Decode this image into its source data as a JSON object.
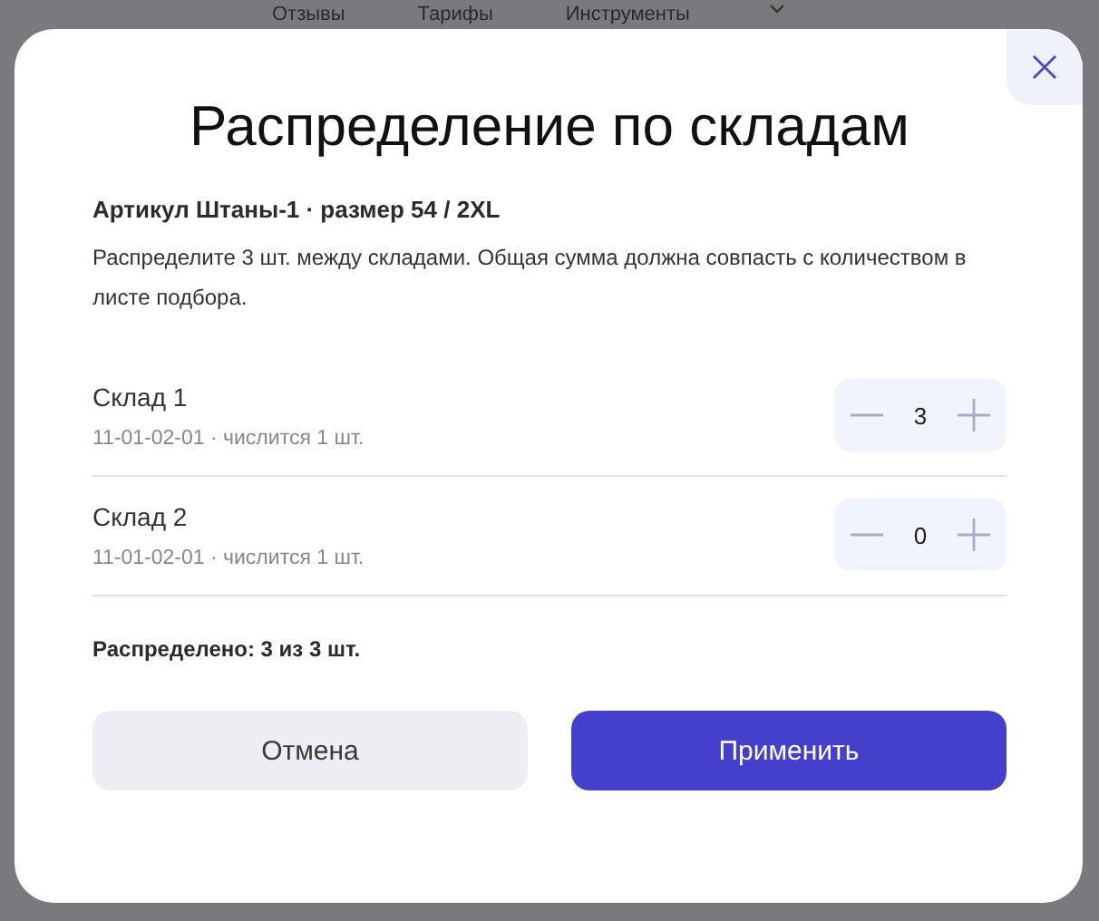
{
  "background_nav": [
    "Отзывы",
    "Тарифы",
    "Инструменты"
  ],
  "dialog": {
    "title": "Распределение по складам",
    "subtitle": "Артикул Штаны-1 · размер 54 / 2XL",
    "description": "Распределите 3 шт. между складами. Общая сумма должна совпасть с количеством в листе подбора.",
    "warehouses": [
      {
        "name": "Склад 1",
        "details": "11-01-02-01 · числится 1 шт.",
        "quantity": "3"
      },
      {
        "name": "Склад 2",
        "details": "11-01-02-01 · числится 1 шт.",
        "quantity": "0"
      }
    ],
    "summary": "Распределено: 3 из 3 шт.",
    "buttons": [
      {
        "label": "Отмена",
        "kind": "secondary"
      },
      {
        "label": "Применить",
        "kind": "primary"
      }
    ]
  }
}
